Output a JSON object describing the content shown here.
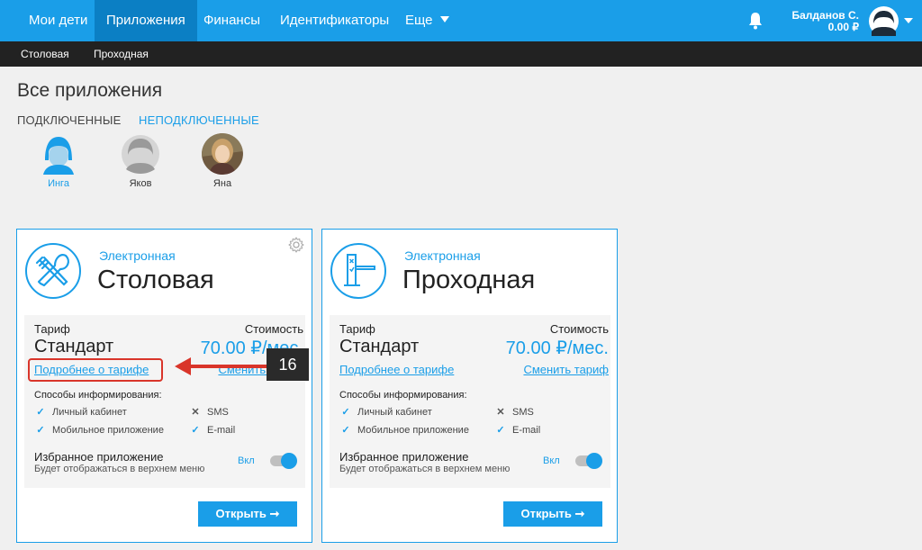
{
  "topbar": {
    "nav": [
      "Мои дети",
      "Приложения",
      "Финансы",
      "Идентификаторы",
      "Еще"
    ],
    "active_nav": "Приложения",
    "user": {
      "name": "Балданов С.",
      "balance": "0.00 ₽"
    },
    "icons": [
      "bell-icon",
      "avatar-icon",
      "chevron-down-icon"
    ]
  },
  "subnav": [
    "Столовая",
    "Проходная"
  ],
  "page": {
    "title": "Все приложения",
    "filters": [
      "ПОДКЛЮЧЕННЫЕ",
      "НЕПОДКЛЮЧЕННЫЕ"
    ]
  },
  "children": [
    {
      "name": "Инга",
      "active": true
    },
    {
      "name": "Яков",
      "active": false
    },
    {
      "name": "Яна",
      "active": false
    }
  ],
  "cards": [
    {
      "subtitle": "Электронная",
      "title": "Столовая",
      "icon": "cutlery-icon",
      "tariff_label": "Тариф",
      "cost_label": "Стоимость",
      "tariff_name": "Стандарт",
      "price": "70.00 ₽/мес.",
      "details_link": "Подробнее о тарифе",
      "change_link": "Сменить тариф",
      "notify_title": "Способы информирования:",
      "notify": [
        {
          "label": "Личный кабинет",
          "enabled": true
        },
        {
          "label": "SMS",
          "enabled": false
        },
        {
          "label": "Мобильное приложение",
          "enabled": true
        },
        {
          "label": "E-mail",
          "enabled": true
        }
      ],
      "fav_title": "Избранное приложение",
      "fav_desc": "Будет отображаться в верхнем меню",
      "toggle_label": "Вкл",
      "open_button": "Открыть"
    },
    {
      "subtitle": "Электронная",
      "title": "Проходная",
      "icon": "turnstile-icon",
      "tariff_label": "Тариф",
      "cost_label": "Стоимость",
      "tariff_name": "Стандарт",
      "price": "70.00 ₽/мес.",
      "details_link": "Подробнее о тарифе",
      "change_link": "Сменить тариф",
      "notify_title": "Способы информирования:",
      "notify": [
        {
          "label": "Личный кабинет",
          "enabled": true
        },
        {
          "label": "SMS",
          "enabled": false
        },
        {
          "label": "Мобильное приложение",
          "enabled": true
        },
        {
          "label": "E-mail",
          "enabled": true
        }
      ],
      "fav_title": "Избранное приложение",
      "fav_desc": "Будет отображаться в верхнем меню",
      "toggle_label": "Вкл",
      "open_button": "Открыть"
    }
  ],
  "annotation": {
    "step": "16"
  },
  "colors": {
    "accent": "#1a9ee8",
    "nav_active": "#0b7fc4",
    "subnav": "#222222",
    "highlight": "#d9352a"
  }
}
